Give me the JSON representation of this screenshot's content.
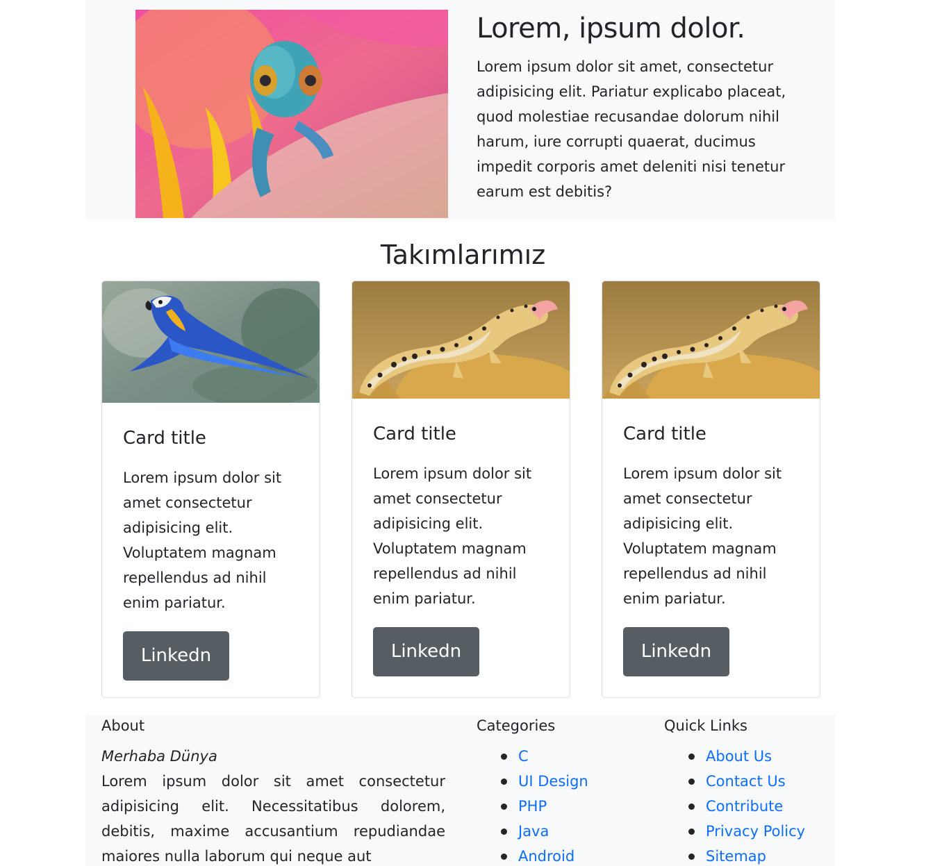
{
  "hero": {
    "title": "Lorem, ipsum dolor.",
    "text": "Lorem ipsum dolor sit amet, consectetur adipisicing elit. Pariatur explicabo placeat, quod molestiae recusandae dolorum nihil harum, iure corrupti quaerat, ducimus impedit corporis amet deleniti nisi tenetur earum est debitis?",
    "image": "chameleon-on-flower-image"
  },
  "section_title": "Takımlarımız",
  "cards": [
    {
      "image": "blue-macaw-image",
      "title": "Card title",
      "text": "Lorem ipsum dolor sit amet consectetur adipisicing elit. Voluptatem magnam repellendus ad nihil enim pariatur.",
      "button": "Linkedn"
    },
    {
      "image": "leopard-gecko-image",
      "title": "Card title",
      "text": "Lorem ipsum dolor sit amet consectetur adipisicing elit. Voluptatem magnam repellendus ad nihil enim pariatur.",
      "button": "Linkedn"
    },
    {
      "image": "leopard-gecko-image",
      "title": "Card title",
      "text": "Lorem ipsum dolor sit amet consectetur adipisicing elit. Voluptatem magnam repellendus ad nihil enim pariatur.",
      "button": "Linkedn"
    }
  ],
  "footer": {
    "about_heading": "About",
    "about_subtitle": "Merhaba Dünya",
    "about_text": "Lorem ipsum dolor sit amet consectetur adipisicing elit. Necessitatibus dolorem, debitis, maxime accusantium repudiandae maiores nulla laborum qui neque aut",
    "categories_heading": "Categories",
    "categories": [
      "C",
      "UI Design",
      "PHP",
      "Java",
      "Android"
    ],
    "quicklinks_heading": "Quick Links",
    "quicklinks": [
      "About Us",
      "Contact Us",
      "Contribute",
      "Privacy Policy",
      "Sitemap"
    ]
  },
  "colors": {
    "button": "#565e64",
    "link": "#0d6efd",
    "panel_bg": "#f8f9fa"
  }
}
